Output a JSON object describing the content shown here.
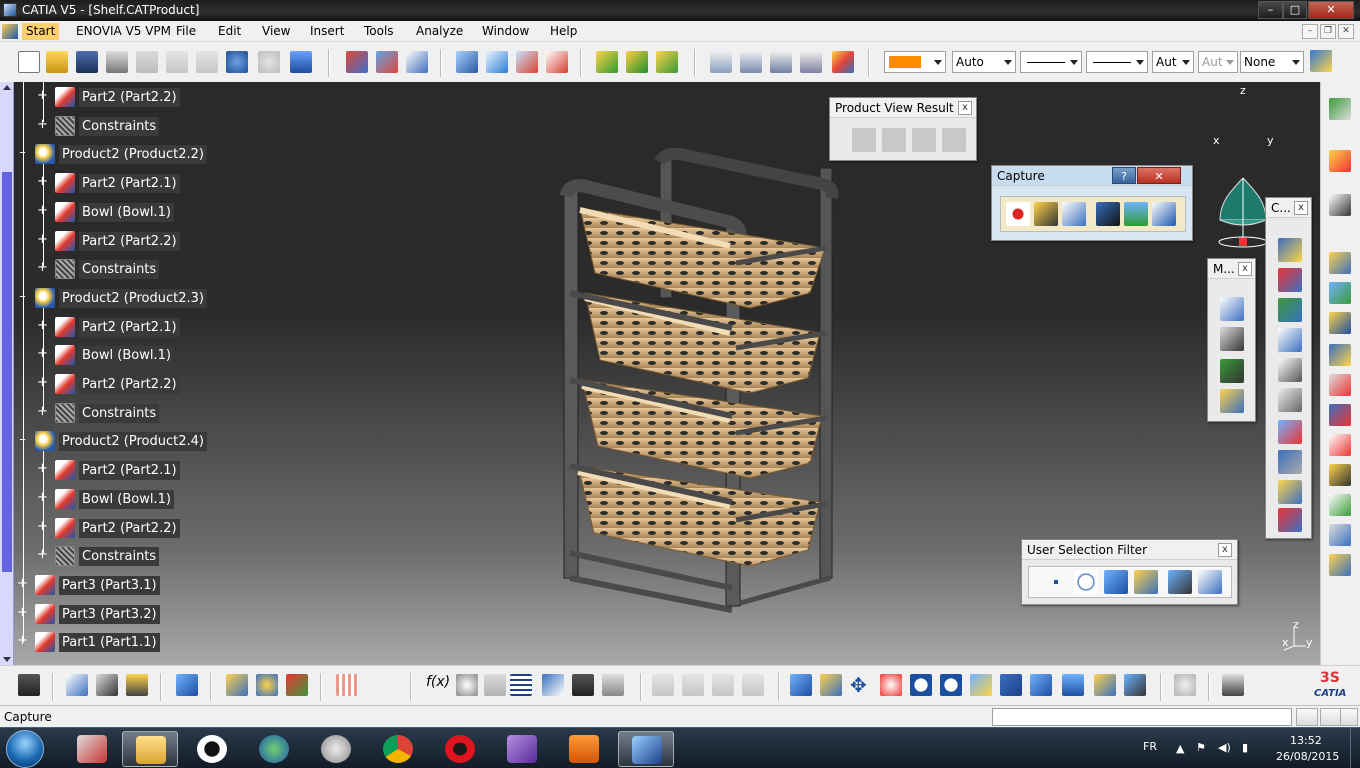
{
  "window": {
    "title": "CATIA V5 - [Shelf.CATProduct]",
    "min": "–",
    "max": "□",
    "close": "✕"
  },
  "menu": {
    "items": [
      "Start",
      "ENOVIA V5 VPM",
      "File",
      "Edit",
      "View",
      "Insert",
      "Tools",
      "Analyze",
      "Window",
      "Help"
    ]
  },
  "toolbar": {
    "color_value": "",
    "accent_color": "#ff8c00",
    "line_combo1": "Auto",
    "combo_aut1": "Aut",
    "combo_aut2": "Aut",
    "combo_none": "None"
  },
  "tree": {
    "nodes": [
      {
        "label": "Part2 (Part2.2)",
        "type": "part",
        "level": 2
      },
      {
        "label": "Constraints",
        "type": "constraints",
        "level": 2
      },
      {
        "label": "Product2 (Product2.2)",
        "type": "product",
        "level": 1
      },
      {
        "label": "Part2 (Part2.1)",
        "type": "part",
        "level": 2
      },
      {
        "label": "Bowl (Bowl.1)",
        "type": "part",
        "level": 2
      },
      {
        "label": "Part2 (Part2.2)",
        "type": "part",
        "level": 2
      },
      {
        "label": "Constraints",
        "type": "constraints",
        "level": 2
      },
      {
        "label": "Product2 (Product2.3)",
        "type": "product",
        "level": 1
      },
      {
        "label": "Part2 (Part2.1)",
        "type": "part",
        "level": 2
      },
      {
        "label": "Bowl (Bowl.1)",
        "type": "part",
        "level": 2
      },
      {
        "label": "Part2 (Part2.2)",
        "type": "part",
        "level": 2
      },
      {
        "label": "Constraints",
        "type": "constraints",
        "level": 2
      },
      {
        "label": "Product2 (Product2.4)",
        "type": "product",
        "level": 1
      },
      {
        "label": "Part2 (Part2.1)",
        "type": "part",
        "level": 2
      },
      {
        "label": "Bowl (Bowl.1)",
        "type": "part",
        "level": 2
      },
      {
        "label": "Part2 (Part2.2)",
        "type": "part",
        "level": 2
      },
      {
        "label": "Constraints",
        "type": "constraints",
        "level": 2
      },
      {
        "label": "Part3 (Part3.1)",
        "type": "part",
        "level": 1
      },
      {
        "label": "Part3 (Part3.2)",
        "type": "part",
        "level": 1
      },
      {
        "label": "Part1 (Part1.1)",
        "type": "part",
        "level": 1
      }
    ]
  },
  "panels": {
    "product_view": {
      "title": "Product View Result",
      "close": "x"
    },
    "capture": {
      "title": "Capture",
      "help": "?",
      "close": "✕"
    },
    "c_panel": {
      "title": "C...",
      "close": "x"
    },
    "m_panel": {
      "title": "M...",
      "close": "x"
    },
    "user_filter": {
      "title": "User Selection Filter",
      "close": "x"
    }
  },
  "compass": {
    "z": "z",
    "x": "x",
    "y": "y"
  },
  "axes_corner": {
    "z": "z",
    "x": "x",
    "y": "y"
  },
  "status": {
    "text": "Capture"
  },
  "taskbar": {
    "lang": "FR",
    "time": "13:52",
    "date": "26/08/2015"
  },
  "brand": {
    "logo_text": "CATIA"
  }
}
